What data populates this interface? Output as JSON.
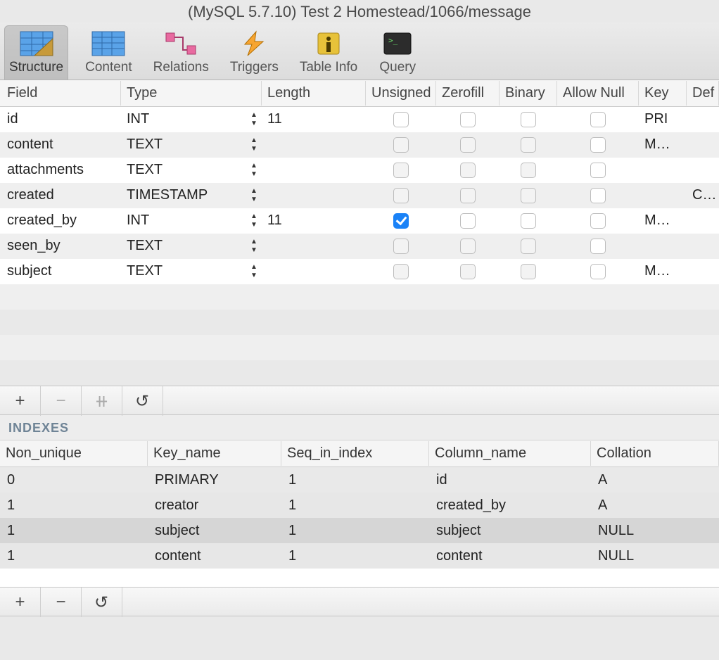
{
  "title": "(MySQL 5.7.10) Test 2 Homestead/1066/message",
  "toolbar": {
    "structure": "Structure",
    "content": "Content",
    "relations": "Relations",
    "triggers": "Triggers",
    "table_info": "Table Info",
    "query": "Query"
  },
  "columns": {
    "field": "Field",
    "type": "Type",
    "length": "Length",
    "unsigned": "Unsigned",
    "zerofill": "Zerofill",
    "binary": "Binary",
    "allow_null": "Allow Null",
    "key": "Key",
    "default": "Def"
  },
  "fields": [
    {
      "field": "id",
      "type": "INT",
      "length": "11",
      "unsigned": false,
      "zerofill": false,
      "binary": false,
      "allow_null": false,
      "key": "PRI",
      "default": ""
    },
    {
      "field": "content",
      "type": "TEXT",
      "length": "",
      "unsigned": false,
      "zerofill": false,
      "binary": false,
      "allow_null": false,
      "key": "M…",
      "default": ""
    },
    {
      "field": "attachments",
      "type": "TEXT",
      "length": "",
      "unsigned": false,
      "zerofill": false,
      "binary": false,
      "allow_null": false,
      "key": "",
      "default": ""
    },
    {
      "field": "created",
      "type": "TIMESTAMP",
      "length": "",
      "unsigned": false,
      "zerofill": false,
      "binary": false,
      "allow_null": false,
      "key": "",
      "default": "CUI"
    },
    {
      "field": "created_by",
      "type": "INT",
      "length": "11",
      "unsigned": true,
      "zerofill": false,
      "binary": false,
      "allow_null": false,
      "key": "M…",
      "default": ""
    },
    {
      "field": "seen_by",
      "type": "TEXT",
      "length": "",
      "unsigned": false,
      "zerofill": false,
      "binary": false,
      "allow_null": false,
      "key": "",
      "default": ""
    },
    {
      "field": "subject",
      "type": "TEXT",
      "length": "",
      "unsigned": false,
      "zerofill": false,
      "binary": false,
      "allow_null": false,
      "key": "M…",
      "default": ""
    }
  ],
  "indexes_label": "INDEXES",
  "idx_columns": {
    "non_unique": "Non_unique",
    "key_name": "Key_name",
    "seq": "Seq_in_index",
    "column_name": "Column_name",
    "collation": "Collation"
  },
  "indexes": [
    {
      "non_unique": "0",
      "key_name": "PRIMARY",
      "seq": "1",
      "column_name": "id",
      "collation": "A"
    },
    {
      "non_unique": "1",
      "key_name": "creator",
      "seq": "1",
      "column_name": "created_by",
      "collation": "A"
    },
    {
      "non_unique": "1",
      "key_name": "subject",
      "seq": "1",
      "column_name": "subject",
      "collation": "NULL"
    },
    {
      "non_unique": "1",
      "key_name": "content",
      "seq": "1",
      "column_name": "content",
      "collation": "NULL"
    }
  ],
  "selected_index": 2,
  "buttons": {
    "add": "+",
    "remove": "−",
    "link": "⧺",
    "refresh": "↻"
  }
}
